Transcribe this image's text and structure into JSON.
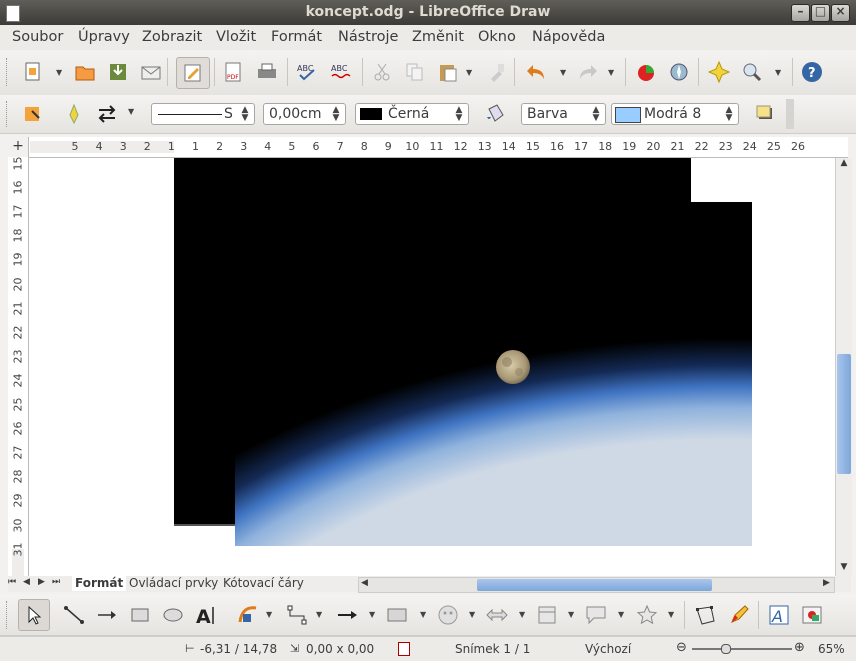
{
  "window": {
    "title": "koncept.odg - LibreOffice Draw"
  },
  "menu": [
    "Soubor",
    "Úpravy",
    "Zobrazit",
    "Vložit",
    "Formát",
    "Nástroje",
    "Změnit",
    "Okno",
    "Nápověda"
  ],
  "line_props": {
    "line_style_suffix": "S",
    "line_width": "0,00cm",
    "line_color": "Černá",
    "area_style": "Barva",
    "area_color": "Modrá 8",
    "line_color_hex": "#000000",
    "area_color_hex": "#99ccff"
  },
  "ruler": {
    "h_labels": [
      "5",
      "4",
      "3",
      "2",
      "1",
      "1",
      "2",
      "3",
      "4",
      "5",
      "6",
      "7",
      "8",
      "9",
      "10",
      "11",
      "12",
      "13",
      "14",
      "15",
      "16",
      "17",
      "18",
      "19",
      "20",
      "21",
      "22",
      "23",
      "24",
      "25",
      "26"
    ],
    "v_labels": [
      "15",
      "16",
      "17",
      "18",
      "19",
      "20",
      "21",
      "22",
      "23",
      "24",
      "25",
      "26",
      "27",
      "28",
      "29",
      "30",
      "31"
    ]
  },
  "tabs": [
    "Formát",
    "Ovládací prvky",
    "Kótovací čáry"
  ],
  "status": {
    "position": "-6,31 / 14,78",
    "size": "0,00 x 0,00",
    "slide": "Snímek 1 / 1",
    "master": "Výchozí",
    "zoom": "65%"
  },
  "icons": {
    "toolbar1": [
      "new-document-icon",
      "open-folder-icon",
      "save-icon",
      "email-icon",
      "edit-document-icon",
      "export-pdf-icon",
      "print-icon",
      "spellcheck-icon",
      "autospell-icon",
      "cut-icon",
      "copy-icon",
      "paste-icon",
      "clone-format-icon",
      "undo-icon",
      "redo-icon",
      "chart-icon",
      "navigator-icon",
      "gluepoints-icon",
      "zoom-icon",
      "help-icon"
    ]
  }
}
